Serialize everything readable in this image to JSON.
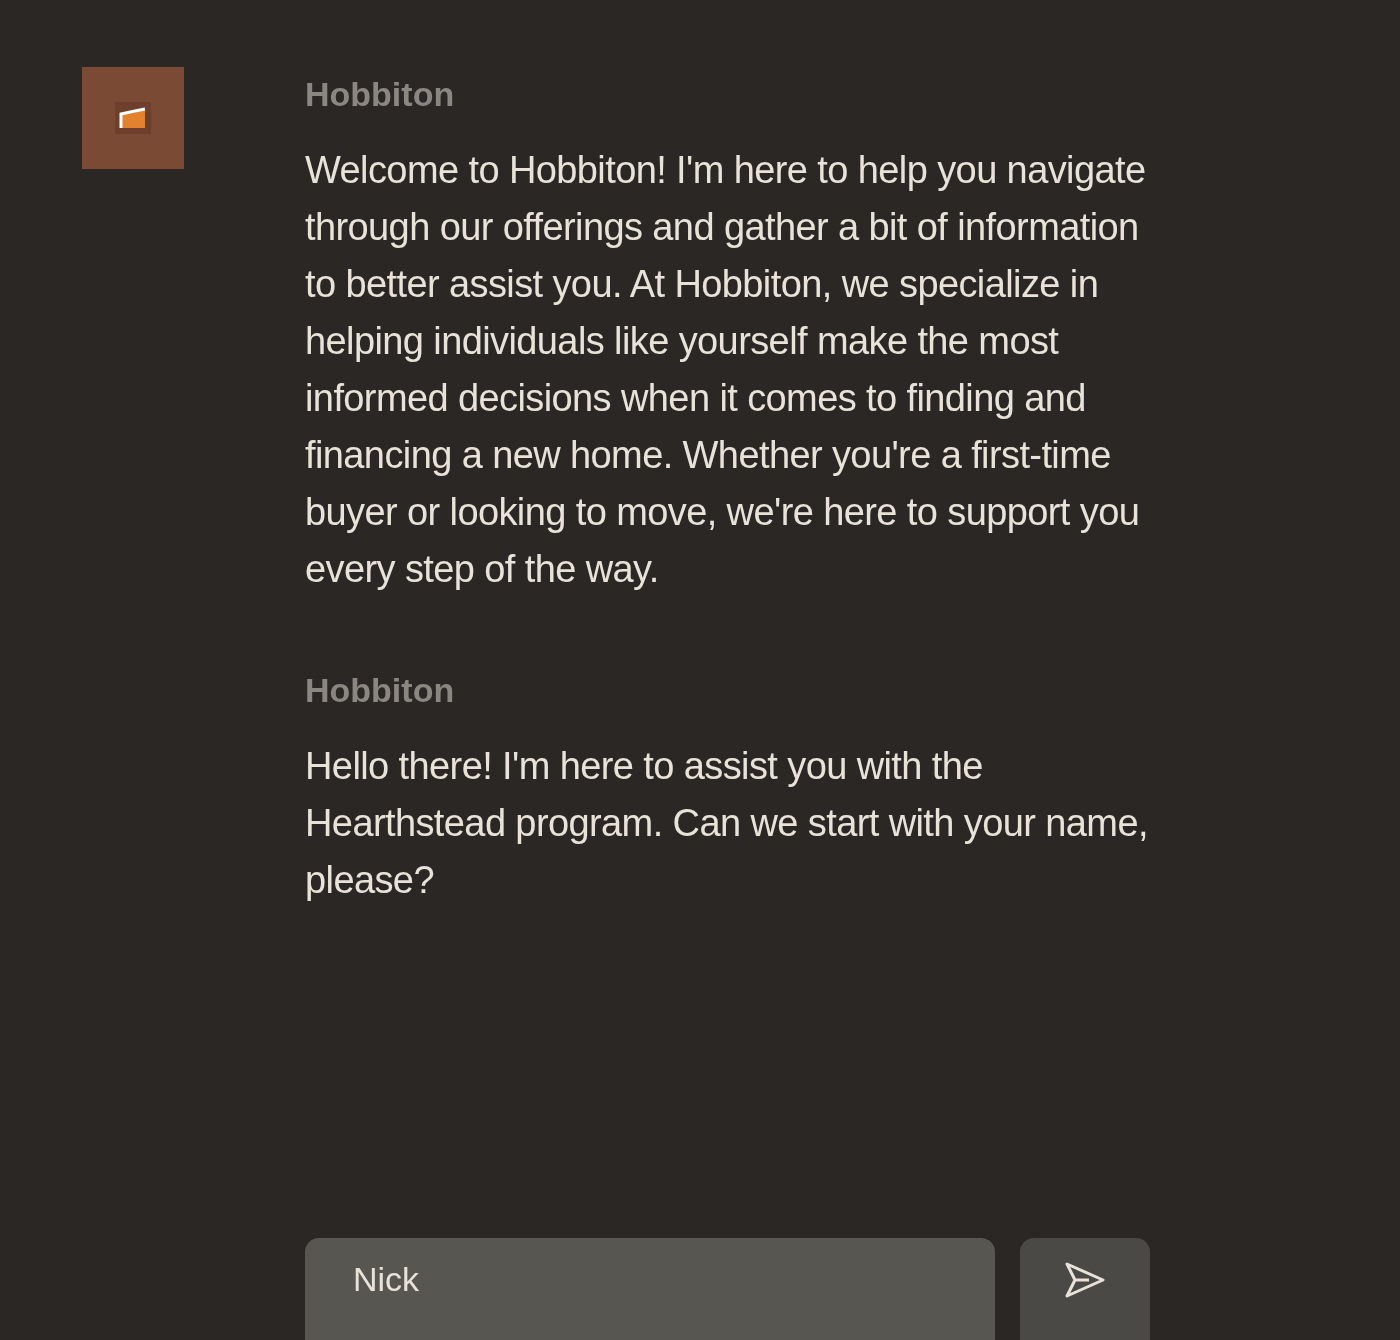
{
  "messages": [
    {
      "sender": "Hobbiton",
      "text": "Welcome to Hobbiton! I'm here to help you navigate through our offerings and gather a bit of information to better assist you. At Hobbiton, we specialize in helping individuals like yourself make the most informed decisions when it comes to finding and financing a new home. Whether you're a first-time buyer or looking to move, we're here to support you every step of the way."
    },
    {
      "sender": "Hobbiton",
      "text": "Hello there! I'm here to assist you with the Hearthstead program. Can we start with your name, please?"
    }
  ],
  "composer": {
    "value": "Nick"
  }
}
